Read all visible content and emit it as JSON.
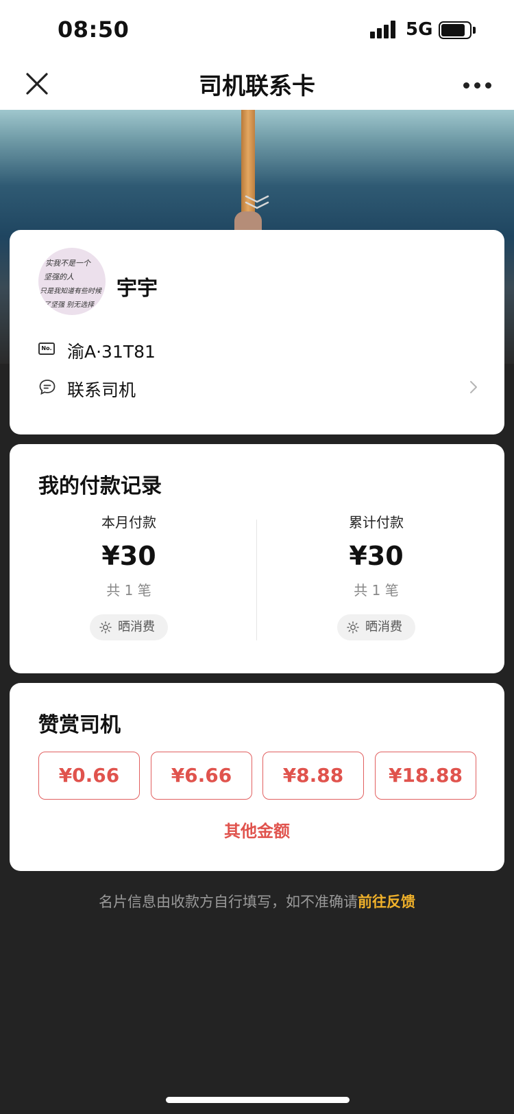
{
  "status_bar": {
    "time": "08:50",
    "network": "5G"
  },
  "nav": {
    "title": "司机联系卡"
  },
  "driver": {
    "avatar_text": [
      "实我不是一个",
      "坚强的人",
      "只是我知道有些时候",
      "了坚强 别无选择"
    ],
    "name": "宇宇",
    "plate": "渝A·31T81",
    "plate_icon_text": "No.",
    "contact_label": "联系司机"
  },
  "payments": {
    "title": "我的付款记录",
    "month": {
      "label": "本月付款",
      "amount": "¥30",
      "count": "共 1 笔",
      "share_label": "晒消费"
    },
    "total": {
      "label": "累计付款",
      "amount": "¥30",
      "count": "共 1 笔",
      "share_label": "晒消费"
    }
  },
  "tip": {
    "title": "赞赏司机",
    "amounts": [
      "¥0.66",
      "¥6.66",
      "¥8.88",
      "¥18.88"
    ],
    "other_label": "其他金额"
  },
  "footer": {
    "note": "名片信息由收款方自行填写，如不准确请",
    "link": "前往反馈"
  },
  "colors": {
    "accent_red": "#e0534d",
    "link_yellow": "#f0b12a",
    "page_bg": "#232323"
  }
}
